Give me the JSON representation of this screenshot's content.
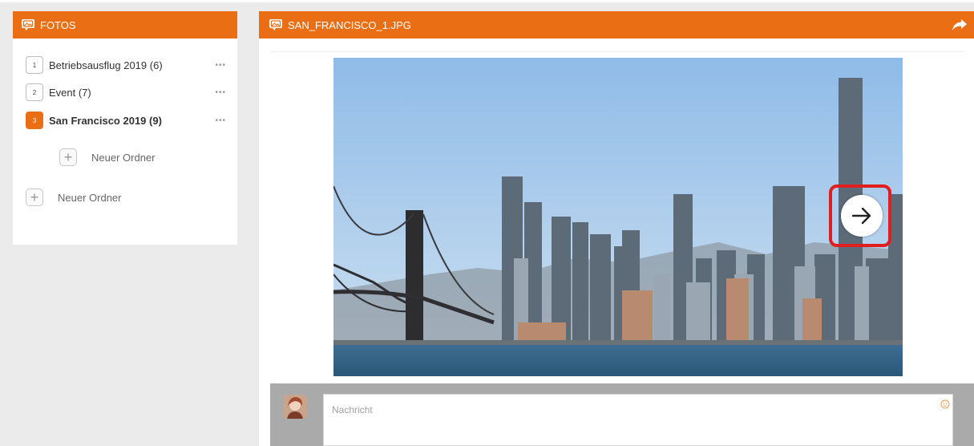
{
  "left_panel": {
    "title": "FOTOS",
    "folders": [
      {
        "number": "1",
        "label": "Betriebsausflug 2019 (6)",
        "active": false
      },
      {
        "number": "2",
        "label": "Event (7)",
        "active": false
      },
      {
        "number": "3",
        "label": "San Francisco 2019 (9)",
        "active": true
      }
    ],
    "more_label": "•••",
    "subfolder_new_label": "Neuer Ordner",
    "root_new_label": "Neuer Ordner"
  },
  "main": {
    "title": "SAN_FRANCISCO_1.JPG",
    "share_icon": "share-arrow-icon",
    "next_icon": "arrow-right-icon",
    "comment": {
      "placeholder": "Nachricht",
      "smiley_icon": "smiley-icon"
    }
  },
  "colors": {
    "accent": "#ea6f14",
    "highlight": "#e01e1e",
    "background": "#ebebeb"
  }
}
